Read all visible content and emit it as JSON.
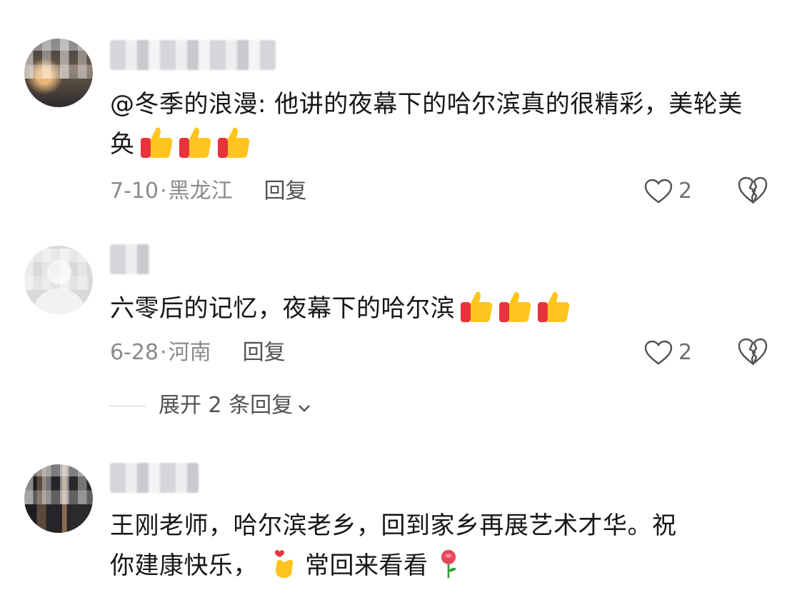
{
  "comments": [
    {
      "text": "@冬季的浪漫: 他讲的夜幕下的哈尔滨真的很精彩，美轮美奂",
      "emojis": [
        "thumbs-up",
        "thumbs-up",
        "thumbs-up"
      ],
      "date": "7-10",
      "location": "黑龙江",
      "reply_label": "回复",
      "likes": "2"
    },
    {
      "text": "六零后的记忆，夜幕下的哈尔滨",
      "emojis": [
        "thumbs-up",
        "thumbs-up",
        "thumbs-up"
      ],
      "date": "6-28",
      "location": "河南",
      "reply_label": "回复",
      "likes": "2",
      "expand_label": "展开 2 条回复"
    },
    {
      "text_line1": "王刚老师，哈尔滨老乡，回到家乡再展艺术才华。祝",
      "text_line2a": "你建康快乐，",
      "text_line2b": "常回来看看",
      "emojis": [
        "heart-hands",
        "rose"
      ]
    }
  ],
  "separator": "·",
  "colors": {
    "meta": "#8a8a8e",
    "text": "#161616",
    "emoji_yellow": "#ffc51e",
    "emoji_red": "#e8333b"
  }
}
